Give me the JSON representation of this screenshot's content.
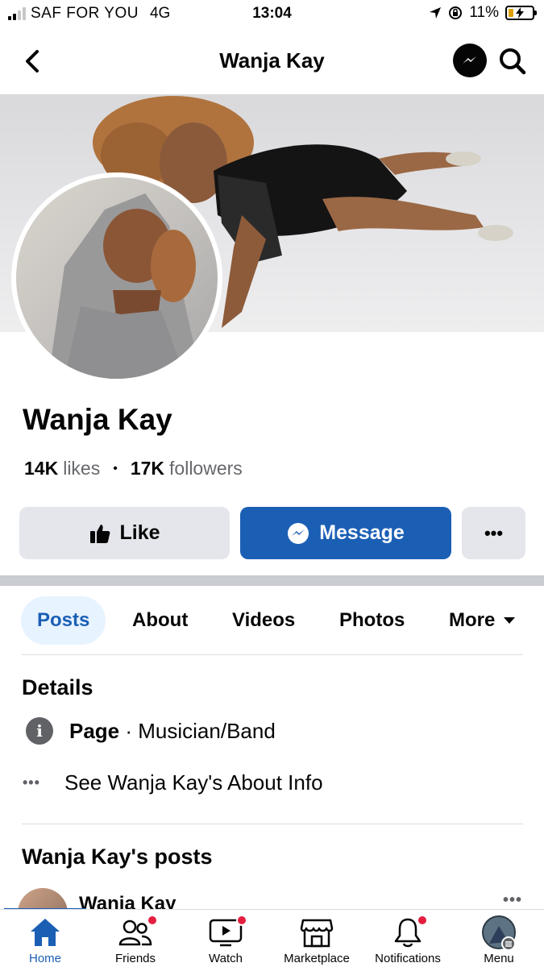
{
  "status_bar": {
    "carrier": "SAF FOR YOU",
    "network": "4G",
    "time": "13:04",
    "battery": "11%"
  },
  "header": {
    "title": "Wanja Kay",
    "back_icon": "chevron-left-icon",
    "messenger_icon": "messenger-icon",
    "search_icon": "search-icon"
  },
  "profile": {
    "name": "Wanja Kay",
    "likes_count": "14K",
    "likes_label": "likes",
    "followers_count": "17K",
    "followers_label": "followers"
  },
  "actions": {
    "like_label": "Like",
    "message_label": "Message",
    "more_label": "•••"
  },
  "tabs": [
    {
      "label": "Posts",
      "active": true
    },
    {
      "label": "About"
    },
    {
      "label": "Videos"
    },
    {
      "label": "Photos"
    },
    {
      "label": "More"
    }
  ],
  "details": {
    "heading": "Details",
    "page_label": "Page",
    "page_category": " · Musician/Band",
    "about_link": "See Wanja Kay's About Info"
  },
  "posts": {
    "heading": "Wanja Kay's posts",
    "author": "Wanja Kay"
  },
  "bottom_nav": [
    {
      "label": "Home",
      "icon": "home-icon",
      "active": true
    },
    {
      "label": "Friends",
      "icon": "friends-icon",
      "badge": true
    },
    {
      "label": "Watch",
      "icon": "watch-icon",
      "badge": true
    },
    {
      "label": "Marketplace",
      "icon": "marketplace-icon"
    },
    {
      "label": "Notifications",
      "icon": "bell-icon",
      "badge": true
    },
    {
      "label": "Menu",
      "icon": "menu-avatar-icon"
    }
  ],
  "colors": {
    "accent": "#1b5fb5",
    "button_grey": "#e4e6eb",
    "badge_red": "#e41e3f",
    "secondary_text": "#65676b"
  }
}
